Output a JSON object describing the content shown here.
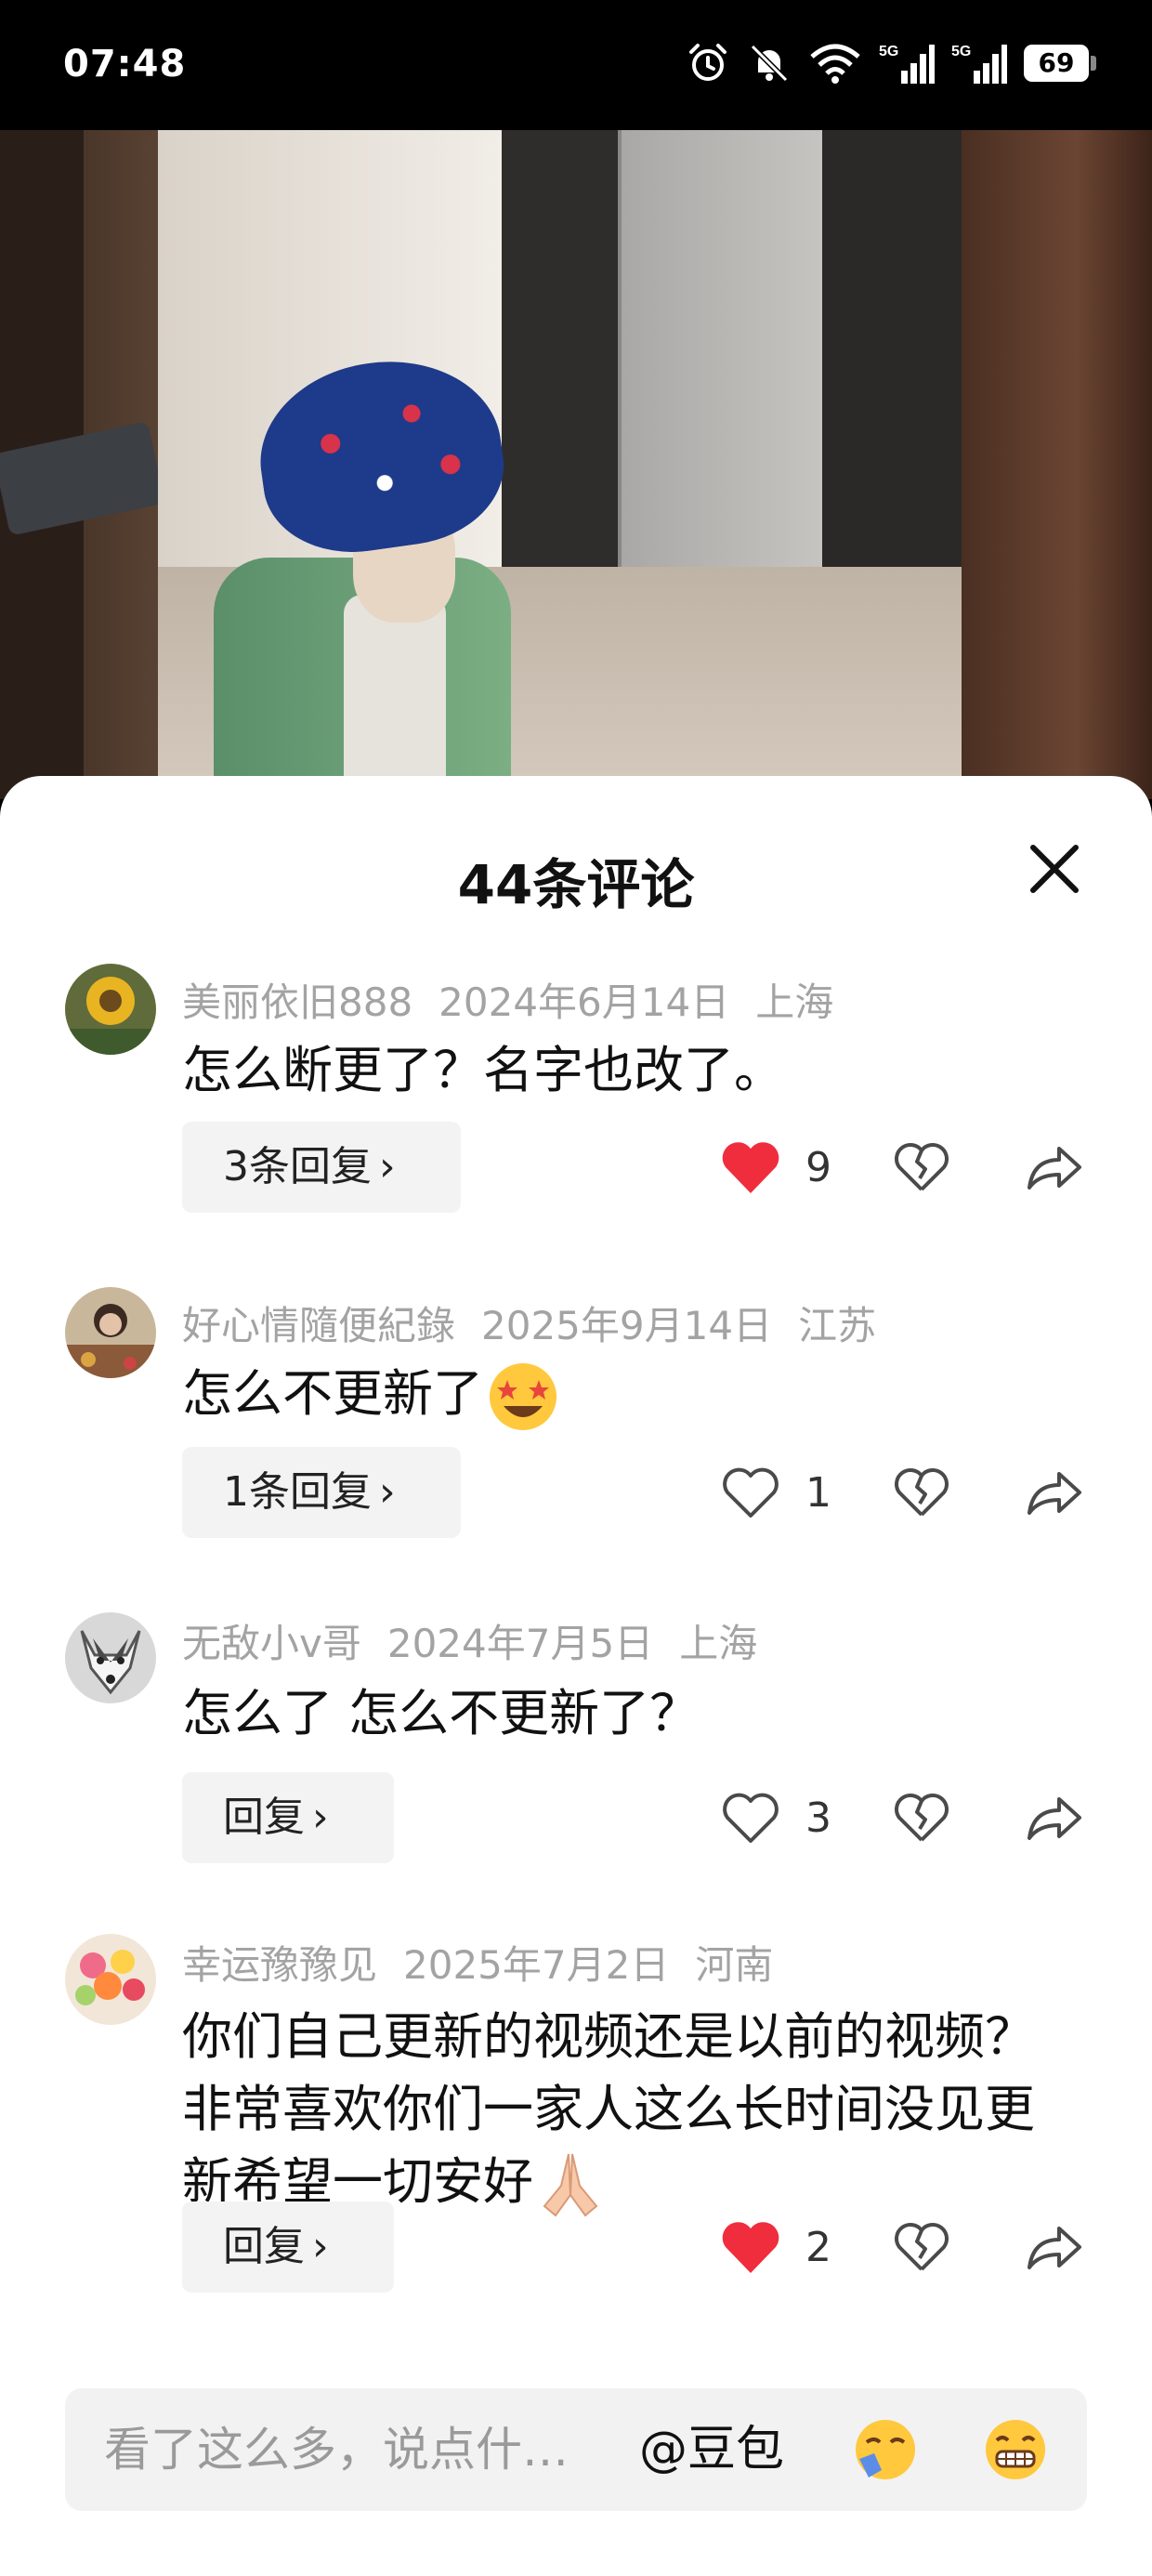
{
  "status_bar": {
    "time": "07:48",
    "network1": "5G",
    "network2": "5G",
    "battery": "69"
  },
  "panel": {
    "title": "44条评论"
  },
  "comments": [
    {
      "username": "美丽依旧888",
      "date": "2024年6月14日",
      "location": "上海",
      "text": "怎么断更了？名字也改了。",
      "reply_label": "3条回复",
      "likes": "9",
      "liked": true
    },
    {
      "username": "好心情隨便紀錄",
      "date": "2025年9月14日",
      "location": "江苏",
      "text": "怎么不更新了",
      "reply_label": "1条回复",
      "likes": "1",
      "liked": false
    },
    {
      "username": "无敌小v哥",
      "date": "2024年7月5日",
      "location": "上海",
      "text": "怎么了 怎么不更新了？",
      "reply_label": "回复",
      "likes": "3",
      "liked": false
    },
    {
      "username": "幸运豫豫见",
      "date": "2025年7月2日",
      "location": "河南",
      "text": "你们自己更新的视频还是以前的视频？非常喜欢你们一家人这么长时间没见更新希望一切安好",
      "reply_label": "回复",
      "likes": "2",
      "liked": true
    }
  ],
  "input_bar": {
    "placeholder": "看了这么多，说点什…",
    "mention": "@豆包"
  },
  "colors": {
    "like_red": "#f02d3c",
    "icon_gray": "#4a4a4a",
    "meta_gray": "#a3a3a3"
  }
}
